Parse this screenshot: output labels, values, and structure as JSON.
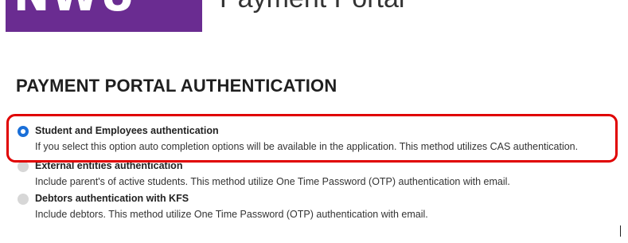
{
  "header": {
    "logo_text": "NWU",
    "portal_title": "Payment Portal"
  },
  "page": {
    "heading": "PAYMENT PORTAL AUTHENTICATION"
  },
  "options": [
    {
      "label": "Student and Employees authentication",
      "description": "If you select this option auto completion options will be available in the application. This method utilizes CAS authentication.",
      "selected": true
    },
    {
      "label": "External entities authentication",
      "description": "Include parent's of active students. This method utilize One Time Password (OTP) authentication with email.",
      "selected": false
    },
    {
      "label": "Debtors authentication with KFS",
      "description": "Include debtors. This method utilize One Time Password (OTP) authentication with email.",
      "selected": false
    }
  ],
  "colors": {
    "brand": "#6a2c91",
    "radio_selected": "#1a6fd8",
    "highlight_border": "#e00000"
  }
}
